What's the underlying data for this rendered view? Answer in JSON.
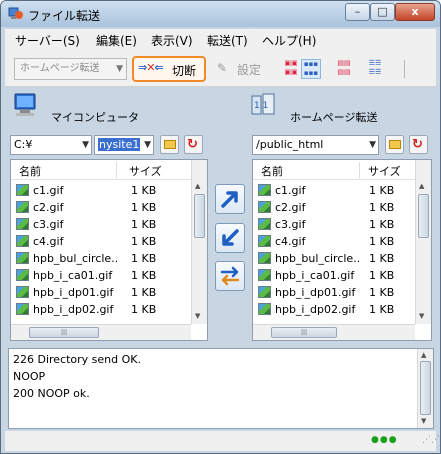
{
  "window": {
    "title": "ファイル転送",
    "minimize": "–",
    "maximize": "□",
    "close": "x"
  },
  "menu": [
    "サーバー(S)",
    "編集(E)",
    "表示(V)",
    "転送(T)",
    "ヘルプ(H)"
  ],
  "toolbar": {
    "profile_combo": "ホームページ転送",
    "disconnect_label": "切断",
    "settings_label": "設定",
    "view_icons": [
      "view-large-icon",
      "view-small-icon",
      "view-list-icon",
      "view-detail-icon"
    ]
  },
  "local": {
    "title": "マイコンピュータ",
    "drive": "C:¥",
    "path": "nysite1",
    "col_name": "名前",
    "col_size": "サイズ",
    "files": [
      {
        "name": "c1.gif",
        "size": "1 KB"
      },
      {
        "name": "c2.gif",
        "size": "1 KB"
      },
      {
        "name": "c3.gif",
        "size": "1 KB"
      },
      {
        "name": "c4.gif",
        "size": "1 KB"
      },
      {
        "name": "hpb_bul_circle...",
        "size": "1 KB"
      },
      {
        "name": "hpb_i_ca01.gif",
        "size": "1 KB"
      },
      {
        "name": "hpb_i_dp01.gif",
        "size": "1 KB"
      },
      {
        "name": "hpb_i_dp02.gif",
        "size": "1 KB"
      }
    ]
  },
  "remote": {
    "title": "ホームページ転送",
    "path": "/public_html",
    "col_name": "名前",
    "col_size": "サイズ",
    "files": [
      {
        "name": "c1.gif",
        "size": "1 KB"
      },
      {
        "name": "c2.gif",
        "size": "1 KB"
      },
      {
        "name": "c3.gif",
        "size": "1 KB"
      },
      {
        "name": "c4.gif",
        "size": "1 KB"
      },
      {
        "name": "hpb_bul_circle...",
        "size": "1 KB"
      },
      {
        "name": "hpb_i_ca01.gif",
        "size": "1 KB"
      },
      {
        "name": "hpb_i_dp01.gif",
        "size": "1 KB"
      },
      {
        "name": "hpb_i_dp02.gif",
        "size": "1 KB"
      }
    ]
  },
  "log": [
    "226  Directory send OK.",
    "NOOP",
    "200  NOOP ok."
  ],
  "status": {
    "indicator": "●●●"
  },
  "colors": {
    "accent": "#f08a2a",
    "selection": "#3a6ecf",
    "status_ok": "#1aa01a"
  }
}
